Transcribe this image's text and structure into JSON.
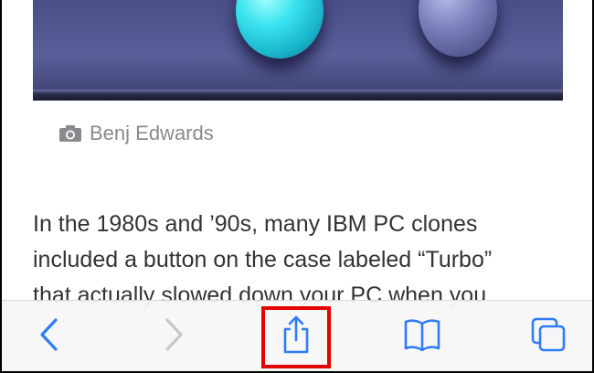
{
  "photo": {
    "alt": "PC case with Turbo and Reset buttons"
  },
  "caption": {
    "icon": "camera-icon",
    "credit": "Benj Edwards"
  },
  "article": {
    "lines": [
      "In the 1980s and ’90s, many IBM PC clones",
      "included a button on the case labeled “Turbo”",
      "that actually slowed down your PC when you"
    ]
  },
  "toolbar": {
    "items": [
      {
        "icon": "back-chevron-icon",
        "state": "enabled"
      },
      {
        "icon": "forward-chevron-icon",
        "state": "disabled"
      },
      {
        "icon": "share-icon",
        "state": "highlighted"
      },
      {
        "icon": "bookmarks-icon",
        "state": "enabled"
      },
      {
        "icon": "tabs-icon",
        "state": "enabled"
      }
    ],
    "tint_color": "#2f7cf6",
    "disabled_color": "#c7c7cc",
    "highlight_color": "#e60000"
  }
}
